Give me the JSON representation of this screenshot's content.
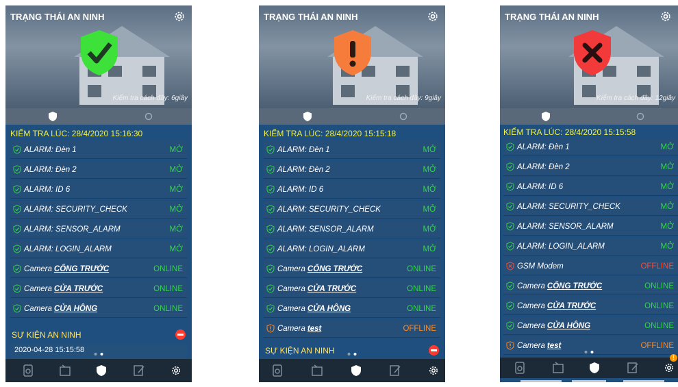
{
  "header": {
    "title": "TRẠNG THÁI AN NINH"
  },
  "colors": {
    "ok": "#36d34c",
    "warn": "#ff8a1f",
    "error": "#ff4b2e",
    "check_time": "#f1f04a",
    "event_header": "#ffe36a"
  },
  "screens": [
    {
      "state": "safe",
      "shield_icon": "green-check-shield-icon",
      "checked_ago": "Kiểm tra cách đây: 6giây",
      "check_time": "KIỂM TRA LÚC: 28/4/2020 15:16:30",
      "rows": [
        {
          "prefix": "ALARM: Đèn 1",
          "cam": "",
          "status": "MỞ",
          "tone": "ok"
        },
        {
          "prefix": "ALARM: Đèn 2",
          "cam": "",
          "status": "MỞ",
          "tone": "ok"
        },
        {
          "prefix": "ALARM: ID 6",
          "cam": "",
          "status": "MỞ",
          "tone": "ok"
        },
        {
          "prefix": "ALARM: SECURITY_CHECK",
          "cam": "",
          "status": "MỞ",
          "tone": "ok"
        },
        {
          "prefix": "ALARM: SENSOR_ALARM",
          "cam": "",
          "status": "MỞ",
          "tone": "ok"
        },
        {
          "prefix": "ALARM: LOGIN_ALARM",
          "cam": "",
          "status": "MỞ",
          "tone": "ok"
        },
        {
          "prefix": "Camera",
          "cam": "CỔNG TRƯỚC",
          "status": "ONLINE",
          "tone": "ok"
        },
        {
          "prefix": "Camera",
          "cam": "CỬA TRƯỚC",
          "status": "ONLINE",
          "tone": "ok"
        },
        {
          "prefix": "Camera",
          "cam": "CỬA HÔNG",
          "status": "ONLINE",
          "tone": "ok"
        }
      ],
      "events_title": "SỰ KIỆN AN NINH",
      "event_row": "2020-04-28 15:15:58",
      "active_tab": 2
    },
    {
      "state": "warning",
      "shield_icon": "orange-exclamation-shield-icon",
      "checked_ago": "Kiểm tra cách đây: 9giây",
      "check_time": "KIỂM TRA LÚC: 28/4/2020 15:15:18",
      "rows": [
        {
          "prefix": "ALARM: Đèn 1",
          "cam": "",
          "status": "MỞ",
          "tone": "ok"
        },
        {
          "prefix": "ALARM: Đèn 2",
          "cam": "",
          "status": "MỞ",
          "tone": "ok"
        },
        {
          "prefix": "ALARM: ID 6",
          "cam": "",
          "status": "MỞ",
          "tone": "ok"
        },
        {
          "prefix": "ALARM: SECURITY_CHECK",
          "cam": "",
          "status": "MỞ",
          "tone": "ok"
        },
        {
          "prefix": "ALARM: SENSOR_ALARM",
          "cam": "",
          "status": "MỞ",
          "tone": "ok"
        },
        {
          "prefix": "ALARM: LOGIN_ALARM",
          "cam": "",
          "status": "MỞ",
          "tone": "ok"
        },
        {
          "prefix": "Camera",
          "cam": "CỔNG TRƯỚC",
          "status": "ONLINE",
          "tone": "ok"
        },
        {
          "prefix": "Camera",
          "cam": "CỬA TRƯỚC",
          "status": "ONLINE",
          "tone": "ok"
        },
        {
          "prefix": "Camera",
          "cam": "CỬA HÔNG",
          "status": "ONLINE",
          "tone": "ok"
        },
        {
          "prefix": "Camera",
          "cam": "test",
          "status": "OFFLINE",
          "tone": "warn"
        }
      ],
      "events_title": "SỰ KIỆN AN NINH",
      "event_row": "",
      "active_tab": 2
    },
    {
      "state": "danger",
      "shield_icon": "red-x-shield-icon",
      "checked_ago": "Kiểm tra cách đây: 12giây",
      "check_time": "KIỂM TRA LÚC: 28/4/2020 15:15:58",
      "rows": [
        {
          "prefix": "ALARM: Đèn 1",
          "cam": "",
          "status": "MỞ",
          "tone": "ok"
        },
        {
          "prefix": "ALARM: Đèn 2",
          "cam": "",
          "status": "MỞ",
          "tone": "ok"
        },
        {
          "prefix": "ALARM: ID 6",
          "cam": "",
          "status": "MỞ",
          "tone": "ok"
        },
        {
          "prefix": "ALARM: SECURITY_CHECK",
          "cam": "",
          "status": "MỞ",
          "tone": "ok"
        },
        {
          "prefix": "ALARM: SENSOR_ALARM",
          "cam": "",
          "status": "MỞ",
          "tone": "ok"
        },
        {
          "prefix": "ALARM: LOGIN_ALARM",
          "cam": "",
          "status": "MỞ",
          "tone": "ok"
        },
        {
          "prefix": "GSM Modem",
          "cam": "",
          "status": "OFFLINE",
          "tone": "error"
        },
        {
          "prefix": "Camera",
          "cam": "CỔNG TRƯỚC",
          "status": "ONLINE",
          "tone": "ok"
        },
        {
          "prefix": "Camera",
          "cam": "CỬA TRƯỚC",
          "status": "ONLINE",
          "tone": "ok"
        },
        {
          "prefix": "Camera",
          "cam": "CỬA HÔNG",
          "status": "ONLINE",
          "tone": "ok"
        },
        {
          "prefix": "Camera",
          "cam": "test",
          "status": "OFFLINE",
          "tone": "warn"
        }
      ],
      "events_title": "",
      "event_row": "",
      "active_tab": 2,
      "settings_badge": "!"
    }
  ],
  "nav_icons": [
    "device-icon",
    "camera-list-icon",
    "security-shield-icon",
    "notes-icon",
    "settings-gear-icon"
  ]
}
